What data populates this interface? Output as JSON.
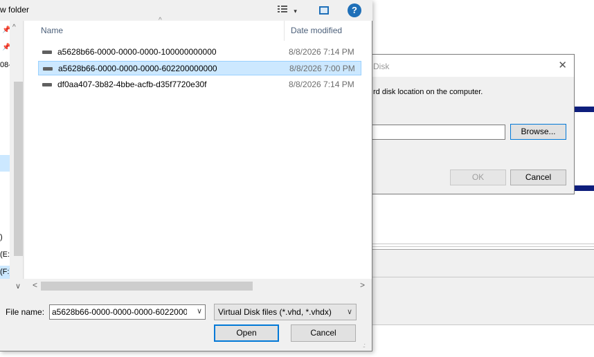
{
  "toolbar": {
    "new_folder_label": "w folder",
    "views_icon": "views-icon",
    "views_arrow": "▾",
    "help_label": "?"
  },
  "nav": {
    "items": [
      "08-",
      ")",
      "(E:)",
      "(F:)"
    ],
    "scroll_up": "^",
    "scroll_down": "∨"
  },
  "file_list": {
    "columns": {
      "name": "Name",
      "date_modified": "Date modified"
    },
    "rows": [
      {
        "name": "a5628b66-0000-0000-0000-100000000000",
        "date": "8/8/2026 7:14 PM",
        "selected": false
      },
      {
        "name": "a5628b66-0000-0000-0000-602200000000",
        "date": "8/8/2026 7:00 PM",
        "selected": true
      },
      {
        "name": "df0aa407-3b82-4bbe-acfb-d35f7720e30f",
        "date": "8/8/2026 7:14 PM",
        "selected": false
      }
    ]
  },
  "hscroll": {
    "left": "<",
    "right": ">"
  },
  "bottom": {
    "file_name_label": "File name:",
    "file_name_value": "a5628b66-0000-0000-0000-6022000",
    "file_type_value": "Virtual Disk files (*.vhd, *.vhdx)",
    "open_label": "Open",
    "cancel_label": "Cancel"
  },
  "attach_dialog": {
    "title": "Disk",
    "close": "✕",
    "description": "rd disk location on the computer.",
    "browse_label": "Browse...",
    "ok_label": "OK",
    "cancel_label": "Cancel"
  },
  "colors": {
    "selection": "#cce8ff",
    "accent": "#0078d7",
    "navy_bar": "#0e1e7c"
  }
}
